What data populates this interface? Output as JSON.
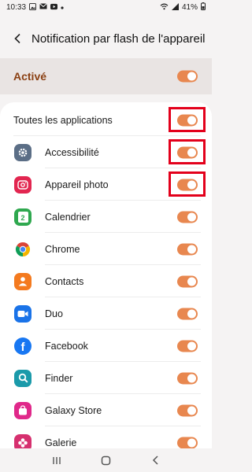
{
  "status_bar": {
    "time": "10:33",
    "battery": "41%",
    "left_icons": [
      "image-icon",
      "mail-icon",
      "play-icon",
      "dot-icon"
    ],
    "right_icons": [
      "wifi-icon",
      "signal-icon",
      "battery-icon"
    ]
  },
  "header": {
    "title": "Notification par flash de l'appareil"
  },
  "active_setting": {
    "label": "Activé",
    "enabled": true
  },
  "all_apps": {
    "label": "Toutes les applications",
    "enabled": true
  },
  "apps": [
    {
      "name": "Accessibilité",
      "icon": "gear-icon",
      "color": "#5b6e86",
      "enabled": true
    },
    {
      "name": "Appareil photo",
      "icon": "camera-icon",
      "color": "#e22650",
      "enabled": true
    },
    {
      "name": "Calendrier",
      "icon": "calendar-icon",
      "color": "#2fa84f",
      "enabled": true,
      "icon_text": "2"
    },
    {
      "name": "Chrome",
      "icon": "chrome-icon",
      "color": "#ffffff",
      "enabled": true
    },
    {
      "name": "Contacts",
      "icon": "person-icon",
      "color": "#f47a1f",
      "enabled": true
    },
    {
      "name": "Duo",
      "icon": "video-icon",
      "color": "#1a73e8",
      "enabled": true
    },
    {
      "name": "Facebook",
      "icon": "facebook-icon",
      "color": "#1877f2",
      "enabled": true,
      "icon_text": "f"
    },
    {
      "name": "Finder",
      "icon": "search-icon",
      "color": "#1b9aaa",
      "enabled": true
    },
    {
      "name": "Galaxy Store",
      "icon": "bag-icon",
      "color": "#e0288a",
      "enabled": true
    },
    {
      "name": "Galerie",
      "icon": "flower-icon",
      "color": "#d6306f",
      "enabled": true
    }
  ],
  "colors": {
    "accent": "#e8874f",
    "highlight": "#e3001b",
    "active_label": "#8a3f12"
  },
  "nav": [
    "recents-icon",
    "home-icon",
    "back-icon"
  ]
}
